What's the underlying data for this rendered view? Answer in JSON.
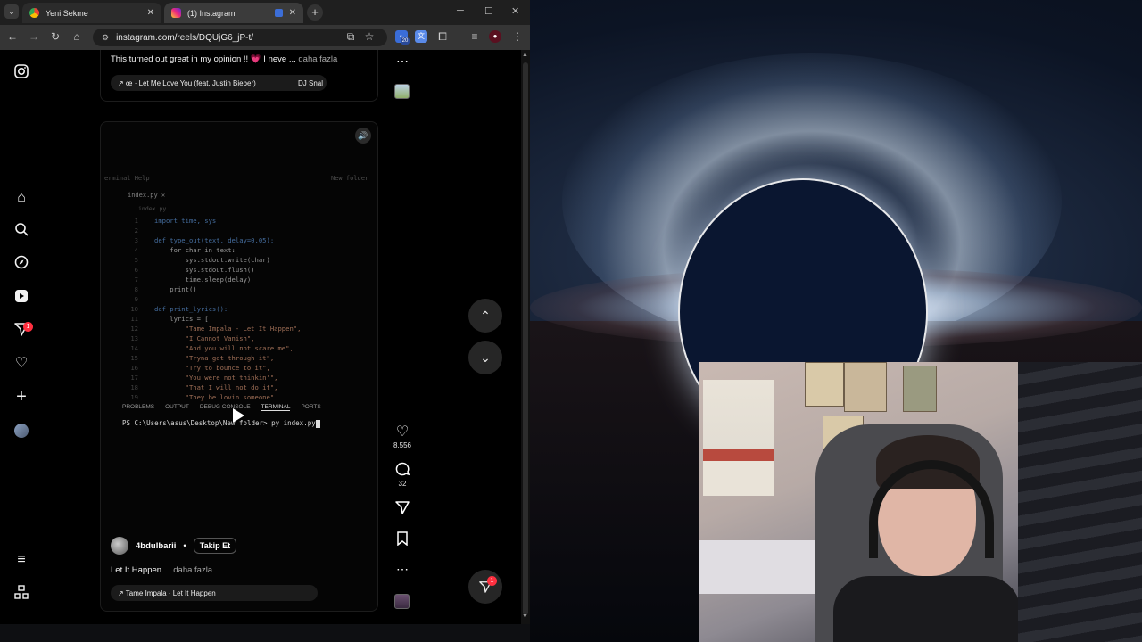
{
  "browser": {
    "tabs": [
      {
        "title": "Yeni Sekme",
        "favicon": "chrome-icon"
      },
      {
        "title": "(1) Instagram",
        "favicon": "instagram-icon"
      }
    ],
    "url": "instagram.com/reels/DQUjG6_jP-t/",
    "extension_badge": "20"
  },
  "nav": {
    "notification_count": "1"
  },
  "reel_top": {
    "caption": "This turned out great in my opinion !! 💗 I neve ...",
    "more": "daha fazla",
    "music": "↗ œ · Let Me Love You (feat. Justin Bieber)",
    "music_artist": "DJ Snal"
  },
  "reel": {
    "code_header": "erminal   Help",
    "code_filetab": "index.py  ✕",
    "code_crumb": "index.py",
    "new_folder": "New folder",
    "code_lines": [
      {
        "n": "1",
        "text": "import time, sys"
      },
      {
        "n": "2",
        "text": ""
      },
      {
        "n": "3",
        "text": "def type_out(text, delay=0.05):"
      },
      {
        "n": "4",
        "text": "    for char in text:"
      },
      {
        "n": "5",
        "text": "        sys.stdout.write(char)"
      },
      {
        "n": "6",
        "text": "        sys.stdout.flush()"
      },
      {
        "n": "7",
        "text": "        time.sleep(delay)"
      },
      {
        "n": "8",
        "text": "    print()"
      },
      {
        "n": "9",
        "text": ""
      },
      {
        "n": "10",
        "text": "def print_lyrics():"
      },
      {
        "n": "11",
        "text": "    lyrics = ["
      },
      {
        "n": "12",
        "text": "        \"Tame Impala - Let It Happen\","
      },
      {
        "n": "13",
        "text": "        \"I Cannot Vanish\","
      },
      {
        "n": "14",
        "text": "        \"And you will not scare me\","
      },
      {
        "n": "15",
        "text": "        \"Tryna get through it\","
      },
      {
        "n": "16",
        "text": "        \"Try to bounce to it\","
      },
      {
        "n": "17",
        "text": "        \"You were not thinkin'\","
      },
      {
        "n": "18",
        "text": "        \"That I will not do it\","
      },
      {
        "n": "19",
        "text": "        \"They be lovin someone\""
      }
    ],
    "terminal_tabs": [
      "PROBLEMS",
      "OUTPUT",
      "DEBUG CONSOLE",
      "TERMINAL",
      "PORTS"
    ],
    "terminal_prompt": "PS C:\\Users\\asus\\Desktop\\New folder> py index.py",
    "author": "4bdulbarii",
    "separator": "•",
    "follow_label": "Takip Et",
    "caption": "Let It Happen ...",
    "more": "daha fazla",
    "music": "↗ Tame Impala · Let It Happen"
  },
  "actions": {
    "likes": "8.556",
    "comments": "32"
  },
  "colors": {
    "accent_badge": "#ff3040",
    "page_bg": "#000000"
  }
}
